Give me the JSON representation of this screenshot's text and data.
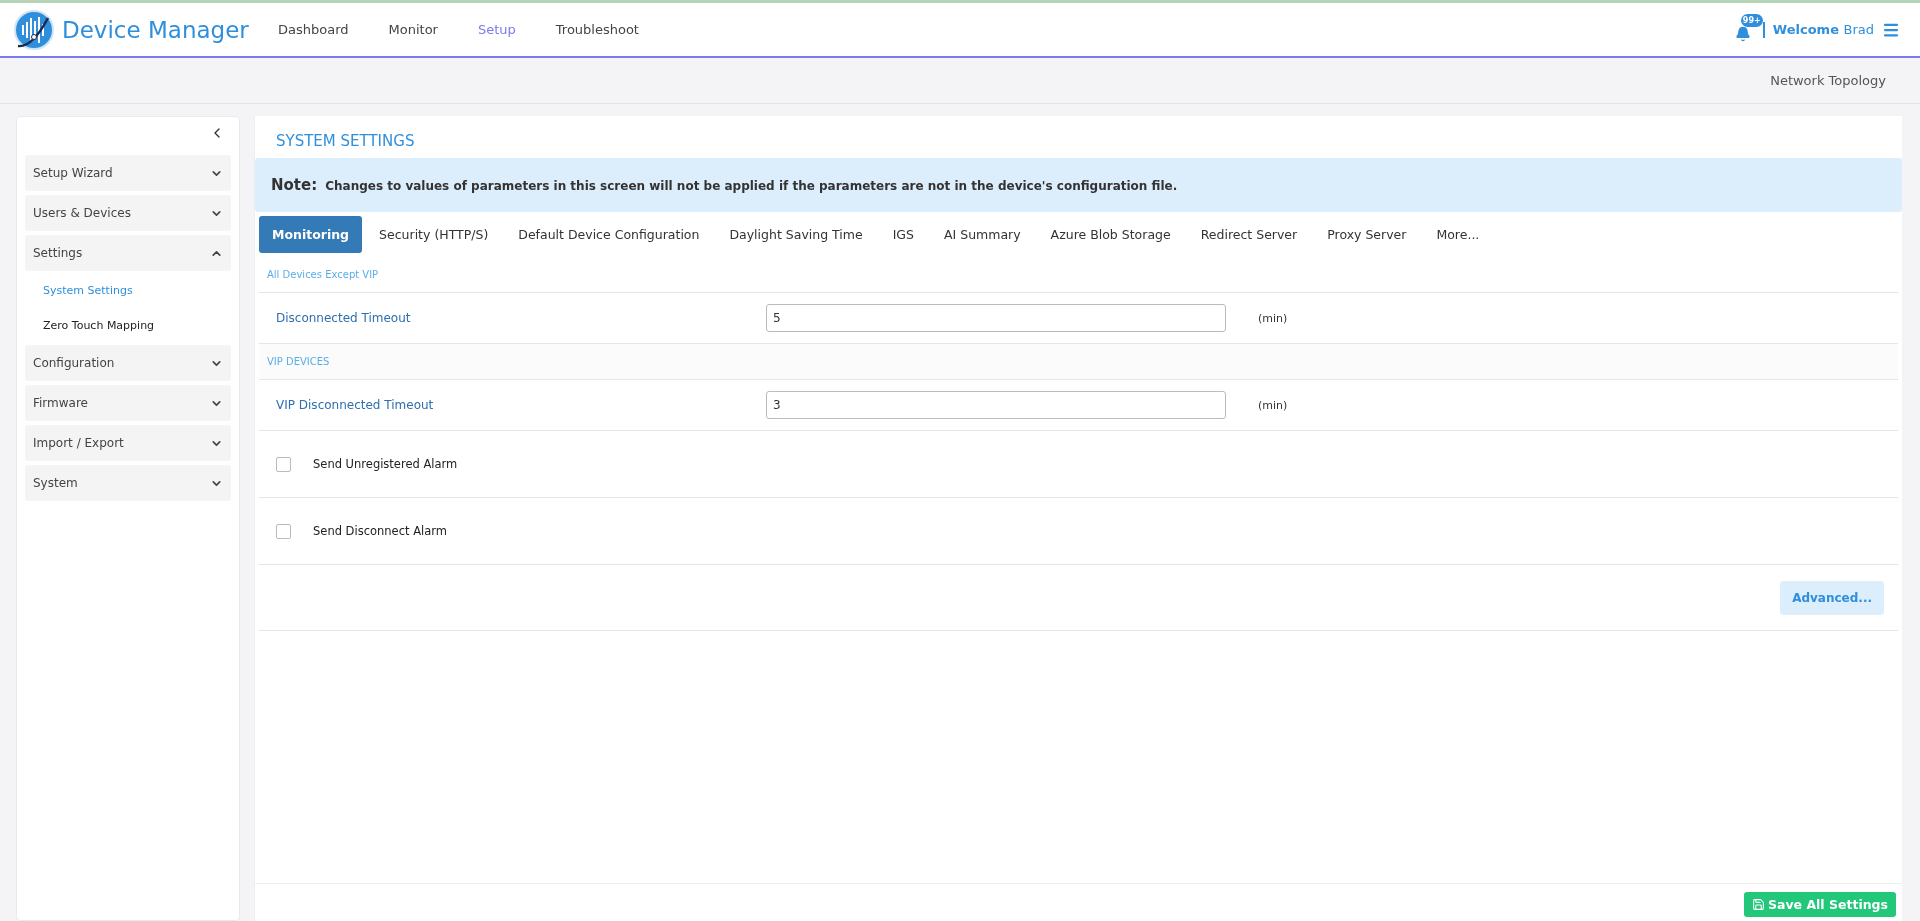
{
  "header": {
    "app_name": "Device Manager",
    "nav": [
      {
        "label": "Dashboard",
        "selected": false
      },
      {
        "label": "Monitor",
        "selected": false
      },
      {
        "label": "Setup",
        "selected": true
      },
      {
        "label": "Troubleshoot",
        "selected": false
      }
    ],
    "notification_badge": "99+",
    "welcome": "Welcome",
    "user": "Brad"
  },
  "subbar": {
    "link": "Network Topology"
  },
  "sidebar": {
    "items": [
      {
        "label": "Setup Wizard",
        "expanded": false
      },
      {
        "label": "Users & Devices",
        "expanded": false
      },
      {
        "label": "Settings",
        "expanded": true,
        "children": [
          {
            "label": "System Settings",
            "selected": true
          },
          {
            "label": "Zero Touch Mapping",
            "selected": false
          }
        ]
      },
      {
        "label": "Configuration",
        "expanded": false
      },
      {
        "label": "Firmware",
        "expanded": false
      },
      {
        "label": "Import / Export",
        "expanded": false
      },
      {
        "label": "System",
        "expanded": false
      }
    ]
  },
  "page_title": "SYSTEM SETTINGS",
  "note": {
    "label": "Note:",
    "text": "Changes to values of parameters in this screen will not be applied if the parameters are not in the device's configuration file."
  },
  "tabs": [
    {
      "label": "Monitoring",
      "selected": true
    },
    {
      "label": "Security (HTTP/S)",
      "selected": false
    },
    {
      "label": "Default Device Configuration",
      "selected": false
    },
    {
      "label": "Daylight Saving Time",
      "selected": false
    },
    {
      "label": "IGS",
      "selected": false
    },
    {
      "label": "AI Summary",
      "selected": false
    },
    {
      "label": "Azure Blob Storage",
      "selected": false
    },
    {
      "label": "Redirect Server",
      "selected": false
    },
    {
      "label": "Proxy Server",
      "selected": false
    },
    {
      "label": "More...",
      "selected": false
    }
  ],
  "rows": [
    {
      "kind": "section",
      "label": "All Devices Except VIP"
    },
    {
      "kind": "input",
      "label": "Disconnected Timeout",
      "value": "5",
      "unit": "(min)"
    },
    {
      "kind": "section",
      "label": "VIP DEVICES"
    },
    {
      "kind": "input",
      "label": "VIP Disconnected Timeout",
      "value": "3",
      "unit": "(min)"
    },
    {
      "kind": "checkbox",
      "label": "Send Unregistered Alarm",
      "checked": false
    },
    {
      "kind": "checkbox",
      "label": "Send Disconnect Alarm",
      "checked": false
    }
  ],
  "advanced_button": "Advanced...",
  "save_button": "Save All Settings"
}
